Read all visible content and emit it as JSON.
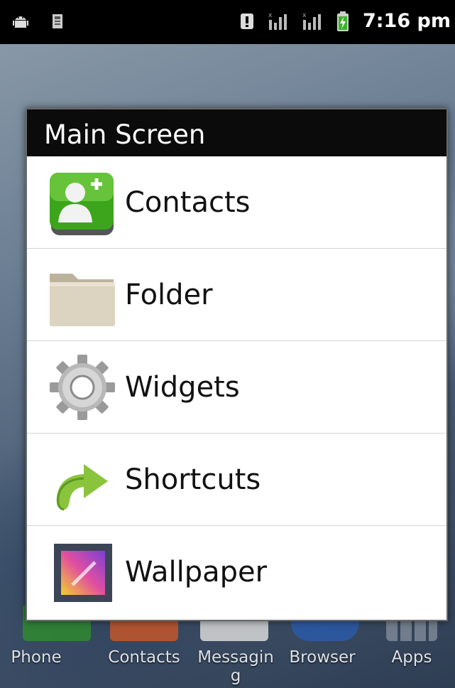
{
  "status_bar": {
    "time": "7:16 pm",
    "icons": [
      "android-debug-icon",
      "sd-card-icon",
      "alert-icon",
      "signal-icon-1",
      "signal-icon-2",
      "battery-charging-icon"
    ]
  },
  "dialog": {
    "title": "Main Screen",
    "items": [
      {
        "label": "Contacts",
        "icon": "contacts-icon"
      },
      {
        "label": "Folder",
        "icon": "folder-icon"
      },
      {
        "label": "Widgets",
        "icon": "gear-icon"
      },
      {
        "label": "Shortcuts",
        "icon": "arrow-icon"
      },
      {
        "label": "Wallpaper",
        "icon": "picture-icon"
      }
    ]
  },
  "dock": {
    "items": [
      {
        "label": "Phone"
      },
      {
        "label": "Contacts"
      },
      {
        "label": "Messagin g"
      },
      {
        "label": "Browser"
      },
      {
        "label": "Apps"
      }
    ]
  },
  "colors": {
    "title_bar": "#0b0b0b",
    "contacts_green": "#3da51c",
    "folder_tan": "#d9d0bd",
    "shortcut_green": "#8ac43c"
  }
}
